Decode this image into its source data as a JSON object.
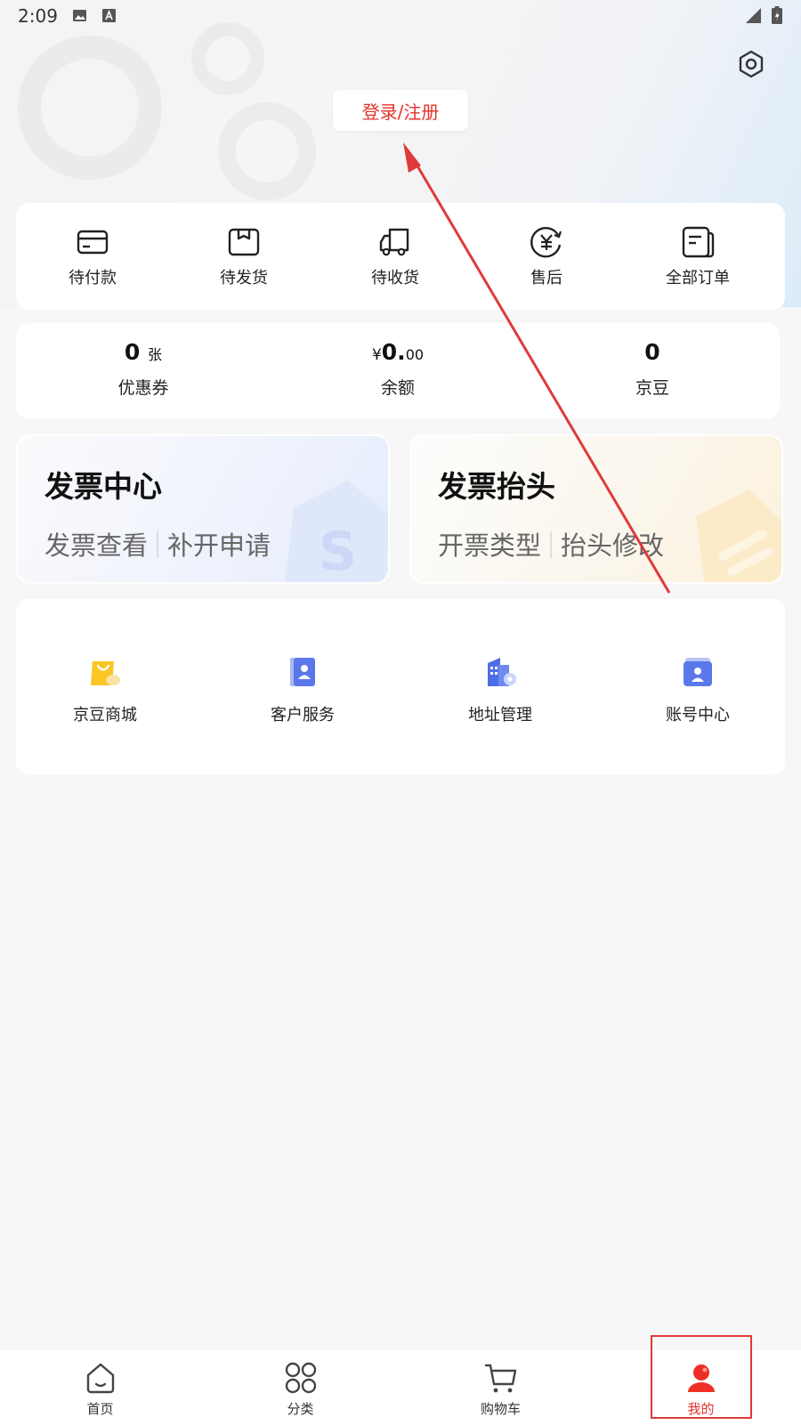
{
  "status_bar": {
    "time": "2:09"
  },
  "header": {
    "login_label": "登录/注册"
  },
  "orders": [
    {
      "label": "待付款",
      "icon": "card-icon"
    },
    {
      "label": "待发货",
      "icon": "box-icon"
    },
    {
      "label": "待收货",
      "icon": "truck-icon"
    },
    {
      "label": "售后",
      "icon": "yen-refresh-icon"
    },
    {
      "label": "全部订单",
      "icon": "orders-list-icon"
    }
  ],
  "assets": {
    "coupons": {
      "value": "0",
      "unit": "张",
      "label": "优惠券"
    },
    "balance": {
      "currency": "¥",
      "value": "0.",
      "decimals": "00",
      "label": "余额"
    },
    "beans": {
      "value": "0",
      "label": "京豆"
    }
  },
  "invoice_center": {
    "title": "发票中心",
    "link1": "发票查看",
    "link2": "补开申请"
  },
  "invoice_header": {
    "title": "发票抬头",
    "link1": "开票类型",
    "link2": "抬头修改"
  },
  "services": [
    {
      "label": "京豆商城",
      "icon": "shopping-bag-icon"
    },
    {
      "label": "客户服务",
      "icon": "contact-book-icon"
    },
    {
      "label": "地址管理",
      "icon": "building-location-icon"
    },
    {
      "label": "账号中心",
      "icon": "account-icon"
    }
  ],
  "tabs": [
    {
      "label": "首页",
      "icon": "home-icon"
    },
    {
      "label": "分类",
      "icon": "category-icon"
    },
    {
      "label": "购物车",
      "icon": "cart-icon"
    },
    {
      "label": "我的",
      "icon": "user-icon"
    }
  ],
  "colors": {
    "accent": "#e4322b",
    "annotation": "#e03a3a"
  }
}
